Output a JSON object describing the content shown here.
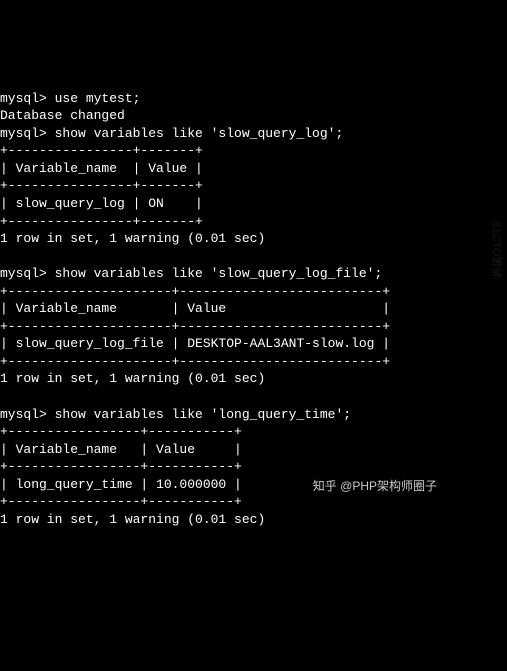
{
  "lines": {
    "l1": "mysql> use mytest;",
    "l2": "Database changed",
    "l3": "mysql> show variables like 'slow_query_log';",
    "l4": "+----------------+-------+",
    "l5": "| Variable_name  | Value |",
    "l6": "+----------------+-------+",
    "l7": "| slow_query_log | ON    |",
    "l8": "+----------------+-------+",
    "l9": "1 row in set, 1 warning (0.01 sec)",
    "l10": "",
    "l11": "mysql> show variables like 'slow_query_log_file';",
    "l12": "+---------------------+--------------------------+",
    "l13": "| Variable_name       | Value                    |",
    "l14": "+---------------------+--------------------------+",
    "l15": "| slow_query_log_file | DESKTOP-AAL3ANT-slow.log |",
    "l16": "+---------------------+--------------------------+",
    "l17": "1 row in set, 1 warning (0.01 sec)",
    "l18": "",
    "l19": "mysql> show variables like 'long_query_time';",
    "l20": "+-----------------+-----------+",
    "l21": "| Variable_name   | Value     |",
    "l22": "+-----------------+-----------+",
    "l23": "| long_query_time | 10.000000 |",
    "l24": "+-----------------+-----------+",
    "l25": "1 row in set, 1 warning (0.01 sec)"
  },
  "watermark": "51CTO博客",
  "attribution": "知乎 @PHP架构师圈子"
}
